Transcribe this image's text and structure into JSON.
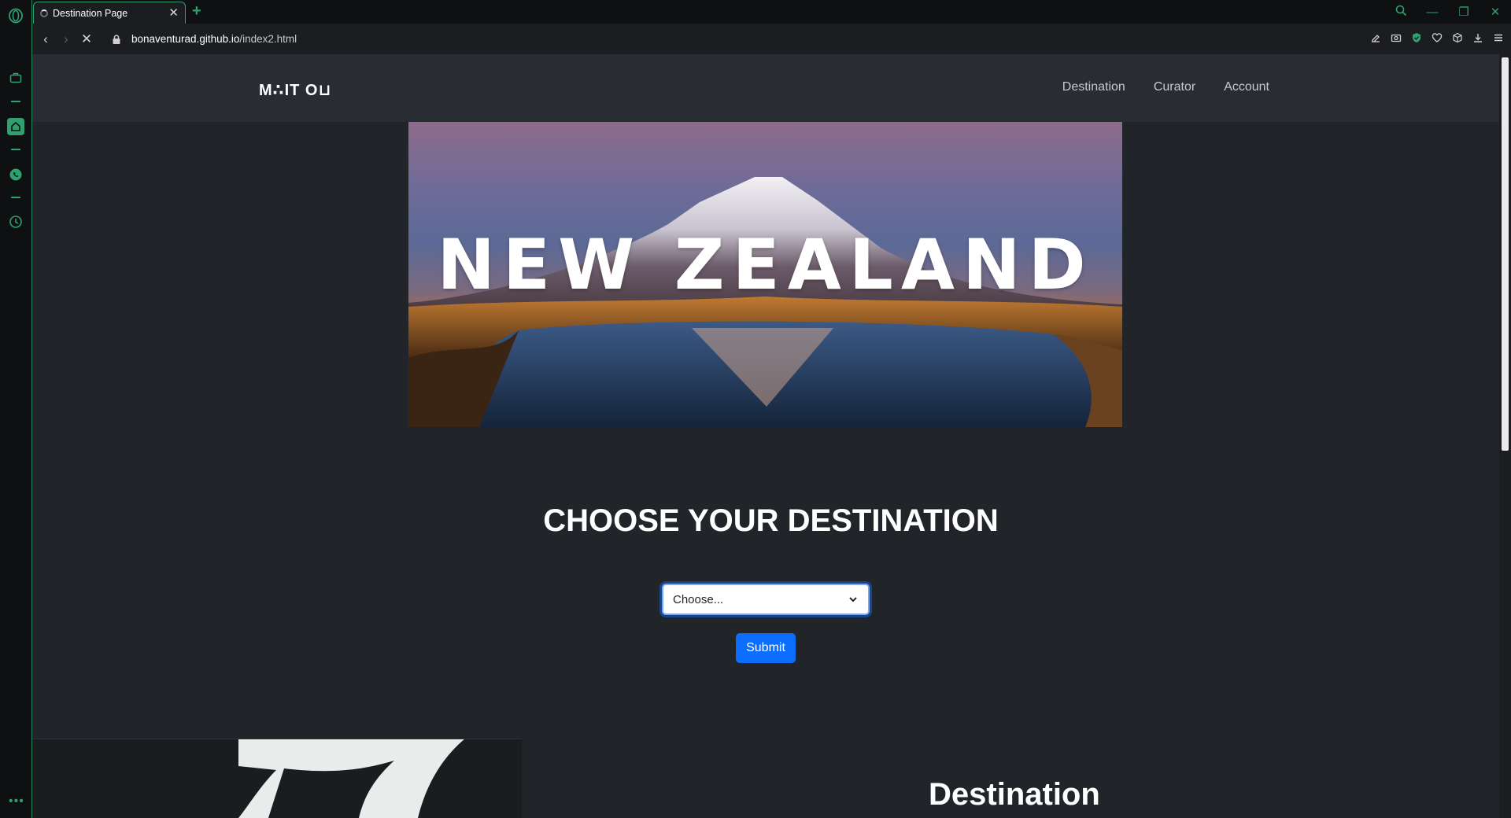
{
  "browser": {
    "tab_title": "Destination Page",
    "url_host": "bonaventurad.github.io",
    "url_path": "/index2.html",
    "accent_color": "#2fa070",
    "sidebar_icons": [
      "opera-logo-icon",
      "briefcase-icon",
      "home-icon",
      "whatsapp-icon",
      "clock-icon",
      "more-icon"
    ],
    "toolbar_icons": [
      "snapshot-icon",
      "camera-icon",
      "shield-icon",
      "heart-icon",
      "cube-icon",
      "download-icon",
      "menu-icon"
    ]
  },
  "site": {
    "logo": "M∴IT O⊔",
    "nav": [
      "Destination",
      "Curator",
      "Account"
    ]
  },
  "hero": {
    "title": "NEW ZEALAND"
  },
  "main": {
    "heading": "CHOOSE YOUR DESTINATION",
    "select_value": "Choose...",
    "submit_label": "Submit",
    "section_heading": "Destination"
  }
}
